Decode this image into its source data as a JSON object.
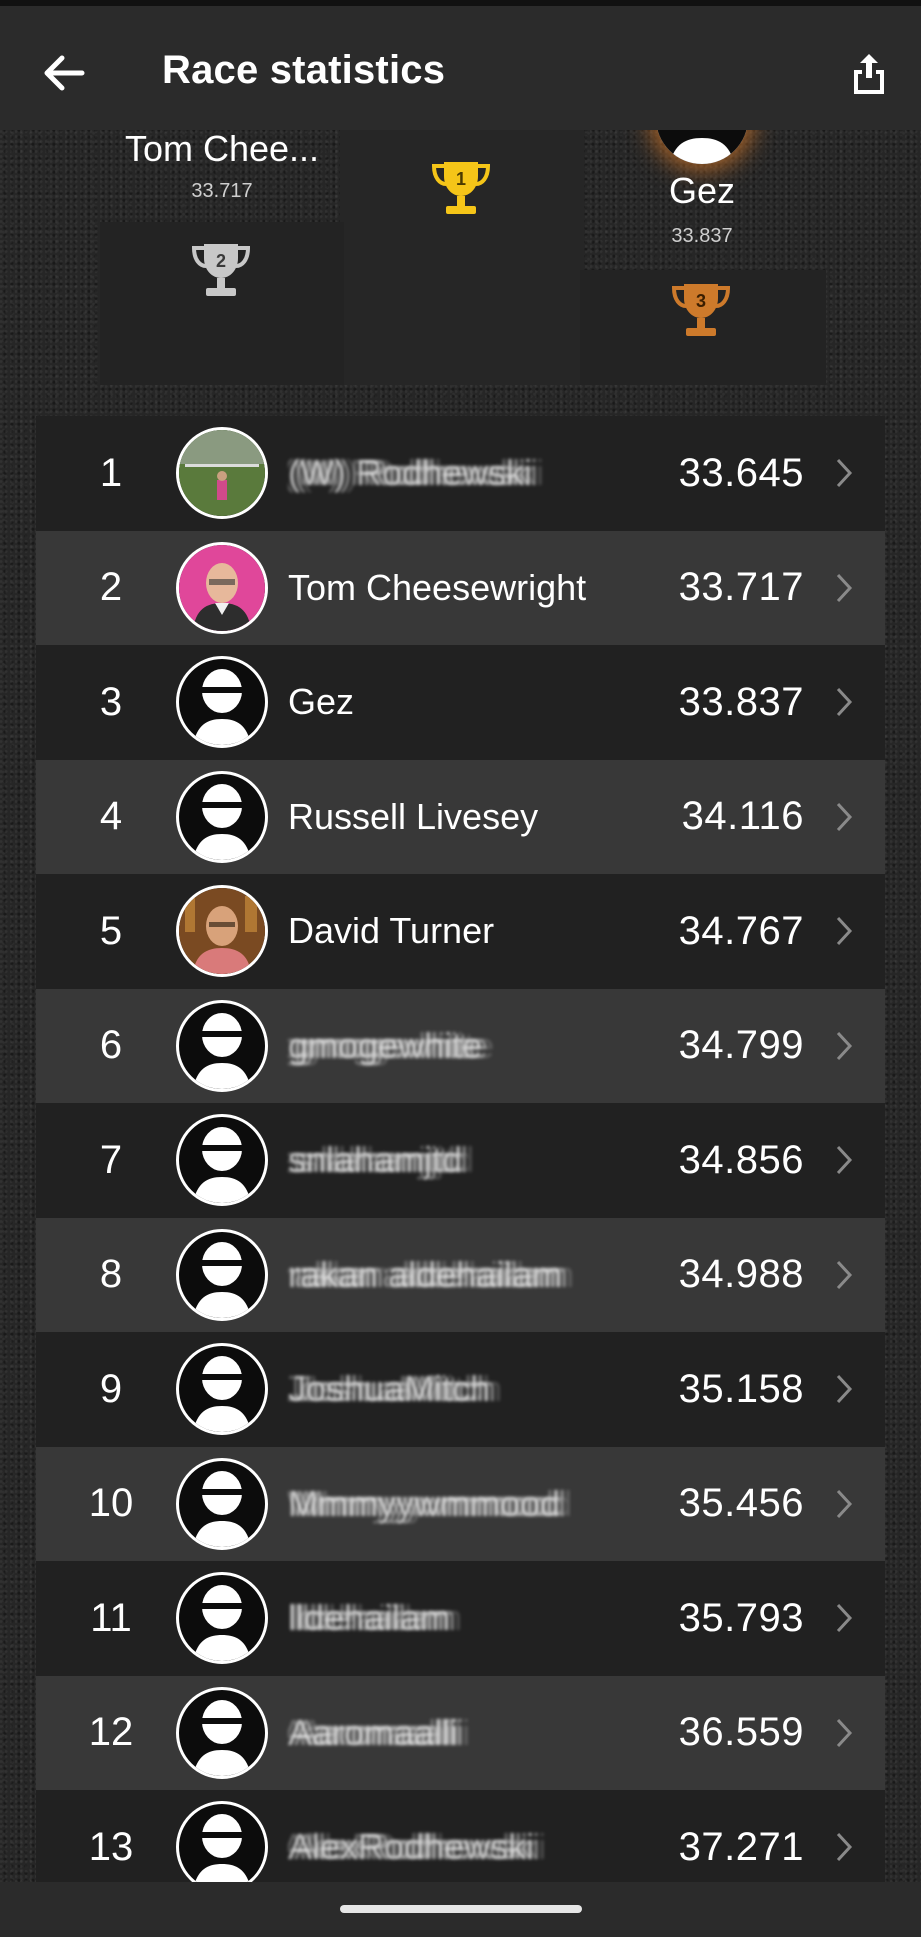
{
  "app_bar": {
    "title": "Race statistics",
    "back_icon": "arrow-left-icon",
    "share_icon": "share-icon"
  },
  "podium": {
    "first": {
      "place": "1",
      "color": "#f5c518"
    },
    "second": {
      "name": "Tom Chee...",
      "time": "33.717",
      "place": "2",
      "color": "#c8c8c8"
    },
    "third": {
      "name": "Gez",
      "time": "33.837",
      "place": "3",
      "color": "#cd7a2b"
    }
  },
  "leaderboard": [
    {
      "rank": "1",
      "name": "(W) Rodhewski",
      "time": "33.645",
      "avatar": "photo-field",
      "blurred": true
    },
    {
      "rank": "2",
      "name": "Tom Cheesewright",
      "time": "33.717",
      "avatar": "photo-pink",
      "blurred": false
    },
    {
      "rank": "3",
      "name": "Gez",
      "time": "33.837",
      "avatar": "default-helmet",
      "blurred": false
    },
    {
      "rank": "4",
      "name": "Russell Livesey",
      "time": "34.116",
      "avatar": "default-helmet",
      "blurred": false
    },
    {
      "rank": "5",
      "name": "David Turner",
      "time": "34.767",
      "avatar": "photo-warm",
      "blurred": false
    },
    {
      "rank": "6",
      "name": "gmogewhite",
      "time": "34.799",
      "avatar": "default-helmet",
      "blurred": true
    },
    {
      "rank": "7",
      "name": "snlahamjtd",
      "time": "34.856",
      "avatar": "default-helmet",
      "blurred": true
    },
    {
      "rank": "8",
      "name": "rakan aldehailam",
      "time": "34.988",
      "avatar": "default-helmet",
      "blurred": true
    },
    {
      "rank": "9",
      "name": "JoshuaMitch",
      "time": "35.158",
      "avatar": "default-helmet",
      "blurred": true
    },
    {
      "rank": "10",
      "name": "Mmmyywmmood",
      "time": "35.456",
      "avatar": "default-helmet",
      "blurred": true
    },
    {
      "rank": "11",
      "name": "lldehailam",
      "time": "35.793",
      "avatar": "default-helmet",
      "blurred": true
    },
    {
      "rank": "12",
      "name": "Aaromaalli",
      "time": "36.559",
      "avatar": "default-helmet",
      "blurred": true
    },
    {
      "rank": "13",
      "name": "AlexRodhewski",
      "time": "37.271",
      "avatar": "default-helmet",
      "blurred": true
    }
  ],
  "row_icon": "chevron-right-icon",
  "colors": {
    "app_bar": "#2b2b2b",
    "row_dark": "#212121",
    "row_light": "#383838",
    "gold": "#f5c518",
    "silver": "#c8c8c8",
    "bronze": "#cd7a2b"
  }
}
